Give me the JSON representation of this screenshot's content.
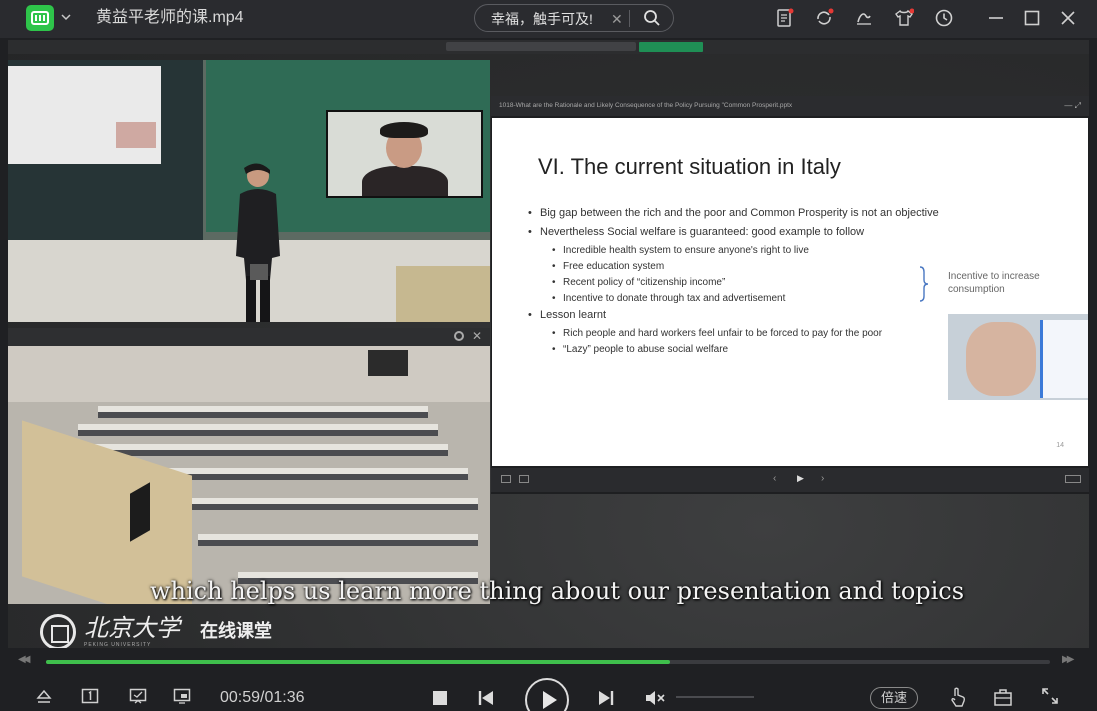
{
  "window": {
    "title": "黄益平老师的课.mp4",
    "search": {
      "value": "幸福，触手可及!"
    }
  },
  "icons": {
    "logo": "iqiyi-logo-icon",
    "dropdown": "chevron-down-icon",
    "search": "search-icon",
    "clear": "close-icon",
    "playlist": "playlist-icon",
    "sync": "sync-icon",
    "hand": "gesture-icon",
    "skin": "tshirt-icon",
    "history": "clock-icon",
    "minimize": "minimize-icon",
    "maximize": "maximize-icon",
    "close": "close-window-icon"
  },
  "video": {
    "slide": {
      "filename": "1018-What are the Rationale and Likely Consequence of the Policy Pursuing \"Common Prosperit.pptx",
      "title": "VI. The current situation in Italy",
      "bullets": [
        {
          "text": "Big gap between the rich and the poor and Common Prosperity is not an objective",
          "sub": []
        },
        {
          "text": "Nevertheless Social welfare is guaranteed: good example to follow",
          "sub": [
            "Incredible health system to ensure anyone's right to live",
            "Free education system",
            "Recent policy of “citizenship income”",
            "Incentive to donate through tax and advertisement"
          ]
        },
        {
          "text": "Lesson learnt",
          "sub": [
            "Rich people and hard workers feel unfair to be forced to pay for the poor",
            "“Lazy” people to abuse social welfare"
          ]
        }
      ],
      "side_note": "Incentive to increase consumption",
      "page_number": "14"
    },
    "subtitle": "which helps us learn more thing about our presentation and topics",
    "watermark": {
      "name": "北京大学",
      "english": "PEKING UNIVERSITY",
      "label": "在线课堂"
    }
  },
  "player": {
    "time": "00:59/01:36",
    "progress": 0.622,
    "speed_label": "倍速",
    "accent": "#3fbf4c"
  }
}
